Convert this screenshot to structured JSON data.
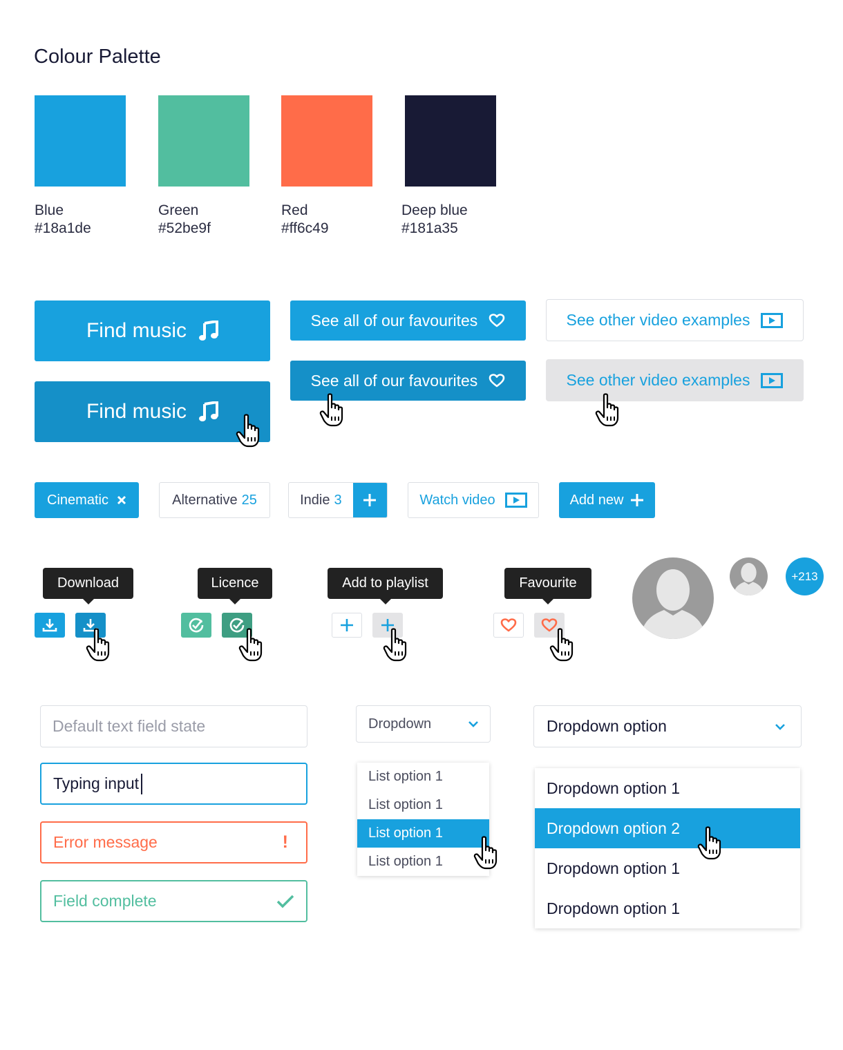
{
  "palette": {
    "title": "Colour Palette",
    "colors": [
      {
        "name": "Blue",
        "hex": "#18a1de"
      },
      {
        "name": "Green",
        "hex": "#52be9f"
      },
      {
        "name": "Red",
        "hex": "#ff6c49"
      },
      {
        "name": "Deep blue",
        "hex": "#181a35"
      }
    ]
  },
  "buttons": {
    "find_music": "Find music",
    "see_favourites": "See all of our favourites",
    "see_videos": "See other video examples"
  },
  "chips": {
    "cinematic": "Cinematic",
    "alternative": "Alternative",
    "alternative_count": "25",
    "indie": "Indie",
    "indie_count": "3",
    "watch_video": "Watch video",
    "add_new": "Add new"
  },
  "tooltips": {
    "download": "Download",
    "licence": "Licence",
    "add_to_playlist": "Add to playlist",
    "favourite": "Favourite"
  },
  "avatars": {
    "more_count": "+213"
  },
  "fields": {
    "default_placeholder": "Default text field state",
    "typing_value": "Typing input",
    "error_text": "Error message",
    "error_icon": "!",
    "complete_text": "Field complete"
  },
  "dropdown_small": {
    "label": "Dropdown",
    "options": [
      "List option 1",
      "List option 1",
      "List option 1",
      "List option 1"
    ],
    "highlighted_index": 2
  },
  "dropdown_large": {
    "label": "Dropdown option",
    "options": [
      "Dropdown option 1",
      "Dropdown option 2",
      "Dropdown option 1",
      "Dropdown option 1"
    ],
    "highlighted_index": 1
  },
  "colors": {
    "blue": "#18a1de",
    "blue_hover": "#1590c8",
    "green": "#52be9f",
    "green_hover": "#3e9e82",
    "red": "#ff6c49",
    "deep_blue": "#181a35",
    "grey_hover": "#e4e4e6"
  }
}
